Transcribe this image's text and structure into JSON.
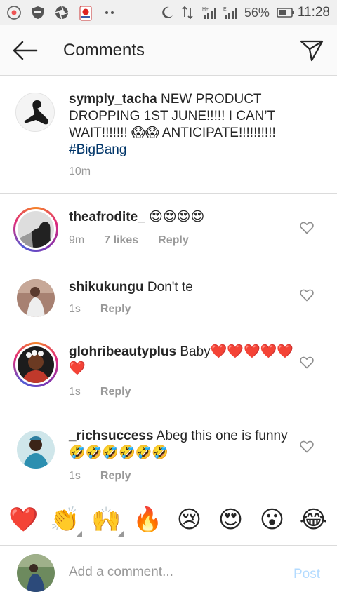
{
  "status_bar": {
    "battery_percent": "56%",
    "time": "11:28",
    "icons": [
      "chrome-icon",
      "shield-icon",
      "aperture-icon",
      "world-cup-icon",
      "dots-icon",
      "moon-icon",
      "data-transfer-icon",
      "signal-h-icon",
      "signal-e-icon",
      "battery-icon"
    ]
  },
  "header": {
    "title": "Comments",
    "back_icon": "arrow-left-icon",
    "send_icon": "paper-plane-icon"
  },
  "caption": {
    "username": "symply_tacha",
    "text_before": " NEW PRODUCT DROPPING 1ST JUNE!!!!! I CAN’T WAIT!!!!!!! ",
    "emoji": "😱😱",
    "text_after": " ANTICIPATE!!!!!!!!!! ",
    "hashtag": "#BigBang",
    "time": "10m"
  },
  "comments": [
    {
      "username": "theafrodite_",
      "text": " 😍😍😍😍",
      "time": "9m",
      "likes": "7 likes",
      "reply": "Reply"
    },
    {
      "username": "shikukungu",
      "text": " Don't te",
      "time": "1s",
      "reply": "Reply"
    },
    {
      "username": "glohribeautyplus",
      "text": " Baby❤️❤️❤️❤️❤️❤️",
      "time": "1s",
      "reply": "Reply"
    },
    {
      "username": "_richsuccess",
      "text": " Abeg this one is funny 🤣🤣🤣🤣🤣🤣",
      "time": "1s",
      "reply": "Reply"
    }
  ],
  "emoji_bar": [
    "❤️",
    "👏",
    "🙌",
    "🔥",
    "😢",
    "😍",
    "😮",
    "😂"
  ],
  "composer": {
    "placeholder": "Add a comment...",
    "post_label": "Post"
  },
  "colors": {
    "accent": "#3897f0",
    "post_disabled": "#b3dbff",
    "hashtag": "#003569",
    "meta_grey": "#999999"
  }
}
